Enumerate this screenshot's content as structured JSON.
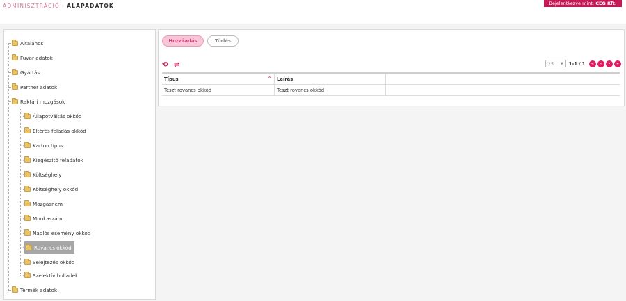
{
  "header": {
    "breadcrumb_root": "ADMINISZTRÁCIÓ",
    "breadcrumb_sep": "›",
    "breadcrumb_current": "ALAPADATOK",
    "login_prefix": "Bejelentkezve mint:",
    "login_user": "CEG Kft."
  },
  "tree": {
    "top_items": [
      "Általános",
      "Fuvar adatok",
      "Gyártás",
      "Partner adatok",
      "Raktári mozgások",
      "Termék adatok"
    ],
    "children": [
      "Állapotváltás okkód",
      "Eltérés feladás okkód",
      "Karton típus",
      "Kiegészítő feladatok",
      "Költséghely",
      "Költséghely okkód",
      "Mozgásnem",
      "Munkaszám",
      "Naplós esemény okkód",
      "Rovancs okkód",
      "Selejtezés okkód",
      "Szelektív hulladék"
    ],
    "selected": "Rovancs okkód"
  },
  "toolbar": {
    "add_label": "Hozzáadás",
    "delete_label": "Törlés",
    "refresh_icon": "refresh-icon",
    "swap_icon": "swap-icon"
  },
  "pager": {
    "page_size": "25",
    "range": "1-1",
    "total": "/ 1",
    "buttons": [
      "first",
      "prev",
      "next",
      "last"
    ]
  },
  "grid": {
    "columns": [
      "Típus",
      "Leírás"
    ],
    "rows": [
      [
        "Teszt rovancs okkód",
        "Teszt rovancs okkód"
      ]
    ]
  },
  "colors": {
    "accent": "#e31a64",
    "badge": "#c31a55",
    "folder": "#e7c46a",
    "selected": "#a6a6a6"
  }
}
